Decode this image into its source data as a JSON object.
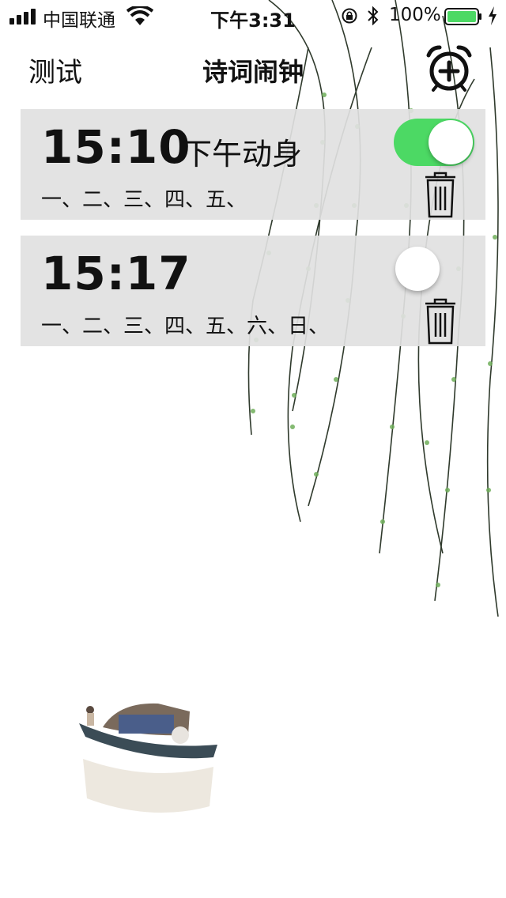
{
  "status_bar": {
    "carrier": "中国联通",
    "time": "下午3:31",
    "battery_percent": "100%",
    "battery_level": 1.0,
    "battery_color": "#4cd964"
  },
  "nav": {
    "left_label": "测试",
    "title": "诗词闹钟",
    "add_icon": "alarm-add-icon"
  },
  "alarms": [
    {
      "time": "15:10",
      "label": "下午动身",
      "days": "一、二、三、四、五、",
      "enabled": true
    },
    {
      "time": "15:17",
      "label": "",
      "days": "一、二、三、四、五、六、日、",
      "enabled": false
    }
  ],
  "colors": {
    "toggle_on": "#4cd964",
    "row_bg": "#e1e1e1"
  }
}
